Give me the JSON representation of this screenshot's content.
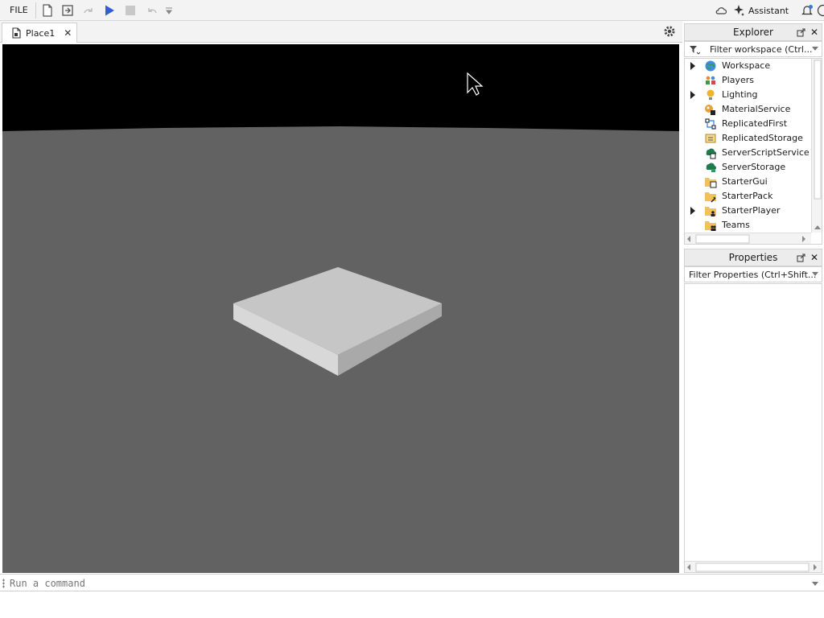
{
  "toolbar": {
    "file_label": "FILE",
    "assistant_label": "Assistant"
  },
  "tabs": [
    {
      "label": "Place1",
      "close": "✕"
    }
  ],
  "explorer": {
    "title": "Explorer",
    "filter_placeholder": "Filter workspace (Ctrl...",
    "items": [
      {
        "label": "Workspace",
        "icon": "workspace-icon",
        "expandable": true
      },
      {
        "label": "Players",
        "icon": "players-icon",
        "expandable": false
      },
      {
        "label": "Lighting",
        "icon": "lighting-icon",
        "expandable": true
      },
      {
        "label": "MaterialService",
        "icon": "material-service-icon",
        "expandable": false
      },
      {
        "label": "ReplicatedFirst",
        "icon": "replicated-first-icon",
        "expandable": false
      },
      {
        "label": "ReplicatedStorage",
        "icon": "replicated-storage-icon",
        "expandable": false
      },
      {
        "label": "ServerScriptService",
        "icon": "server-script-service-icon",
        "expandable": false
      },
      {
        "label": "ServerStorage",
        "icon": "server-storage-icon",
        "expandable": false
      },
      {
        "label": "StarterGui",
        "icon": "starter-gui-icon",
        "expandable": false
      },
      {
        "label": "StarterPack",
        "icon": "starter-pack-icon",
        "expandable": false
      },
      {
        "label": "StarterPlayer",
        "icon": "starter-player-icon",
        "expandable": true
      },
      {
        "label": "Teams",
        "icon": "teams-icon",
        "expandable": false
      }
    ]
  },
  "properties": {
    "title": "Properties",
    "filter_placeholder": "Filter Properties (Ctrl+Shift..."
  },
  "command_bar": {
    "placeholder": "Run a command"
  },
  "colors": {
    "play": "#2f5fd6",
    "sky": "#000000",
    "baseplate": "#626262",
    "part_top": "#c6c6c6"
  }
}
